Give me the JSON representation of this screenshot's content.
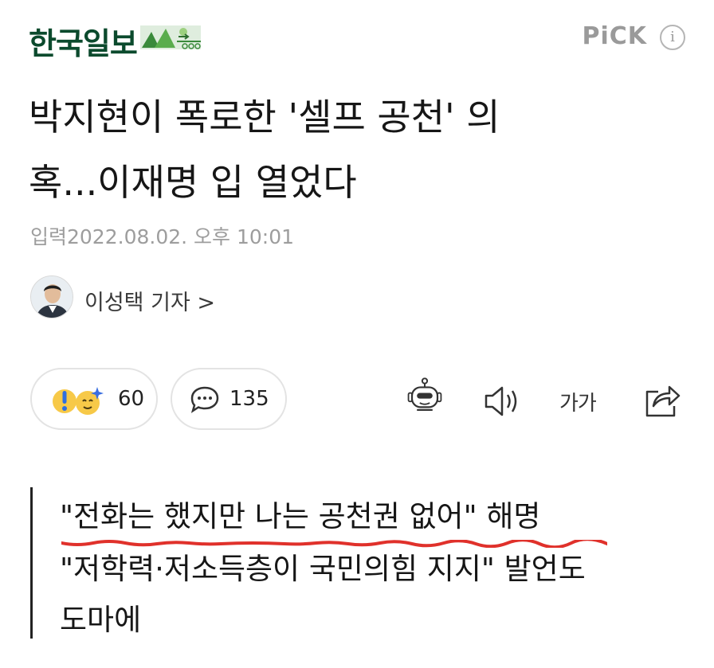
{
  "header": {
    "logo": "한국일보",
    "pick_label": "PiCK",
    "info_label": "i"
  },
  "article": {
    "headline_line1": "박지현이 폭로한 '셀프 공천' 의",
    "headline_line2": "혹...이재명 입 열었다",
    "dateline": "입력2022.08.02. 오후 10:01",
    "reporter": "이성택 기자 >"
  },
  "actions": {
    "reaction_count": "60",
    "comment_count": "135",
    "font_size_label": "가가"
  },
  "summary": {
    "line1": "\"전화는 했지만 나는 공천권 없어\" 해명",
    "line2": "\"저학력·저소득층이 국민의힘 지지\" 발언도",
    "line3": "도마에"
  },
  "colors": {
    "brand_green": "#0b4a2d",
    "underline_red": "#e0312b"
  },
  "icons": [
    "leaf-landscape-logo-icon",
    "info-icon",
    "surprised-emoji-icon",
    "sparkle-face-emoji-icon",
    "comment-icon",
    "robot-summary-icon",
    "speaker-icon",
    "share-icon"
  ]
}
